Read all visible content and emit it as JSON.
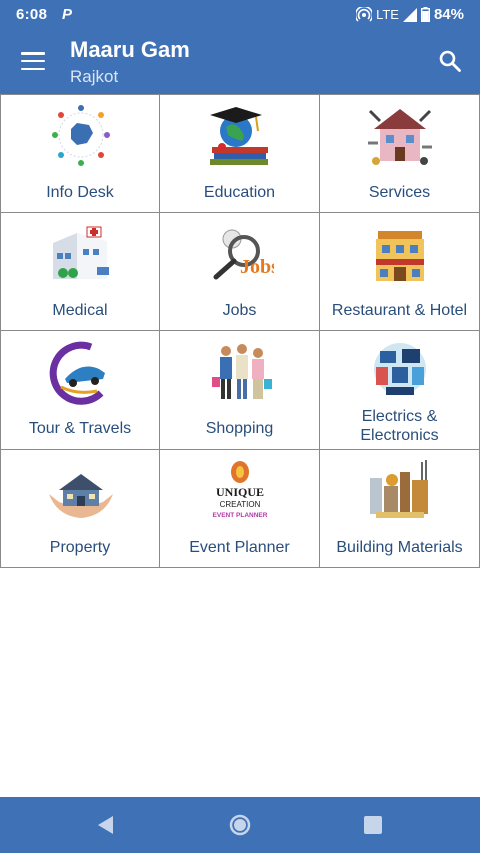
{
  "status": {
    "time": "6:08",
    "lte": "LTE",
    "battery": "84%"
  },
  "appbar": {
    "title": "Maaru Gam",
    "subtitle": "Rajkot"
  },
  "categories": [
    {
      "label": "Info Desk",
      "icon": "info-desk-icon"
    },
    {
      "label": "Education",
      "icon": "education-icon"
    },
    {
      "label": "Services",
      "icon": "services-icon"
    },
    {
      "label": "Medical",
      "icon": "medical-icon"
    },
    {
      "label": "Jobs",
      "icon": "jobs-icon"
    },
    {
      "label": "Restaurant & Hotel",
      "icon": "restaurant-hotel-icon"
    },
    {
      "label": "Tour & Travels",
      "icon": "tour-travels-icon"
    },
    {
      "label": "Shopping",
      "icon": "shopping-icon"
    },
    {
      "label": "Electrics & Electronics",
      "icon": "electrics-electronics-icon"
    },
    {
      "label": "Property",
      "icon": "property-icon"
    },
    {
      "label": "Event Planner",
      "icon": "event-planner-icon"
    },
    {
      "label": "Building Materials",
      "icon": "building-materials-icon"
    }
  ],
  "logo_text": {
    "jobs": "Jobs",
    "unique": "UNIQUE",
    "creation": "CREATION",
    "event_planner": "EVENT PLANNER"
  },
  "colors": {
    "primary": "#3f71b7",
    "label": "#2a4e7c",
    "divider": "#8a8a8a"
  }
}
